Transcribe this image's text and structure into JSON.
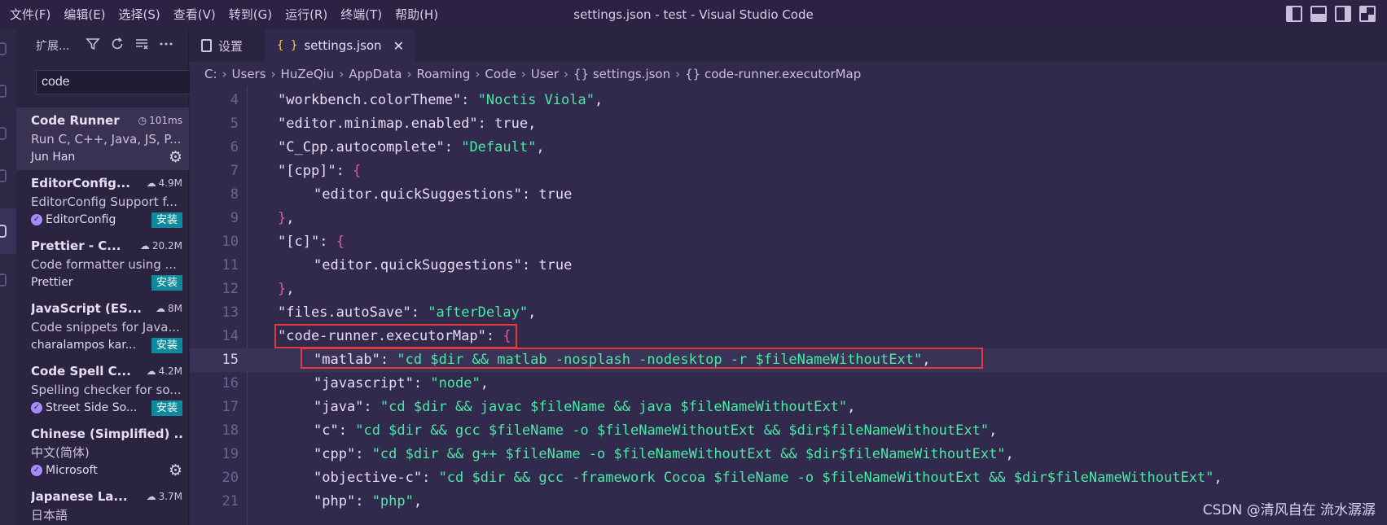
{
  "menu": [
    "文件(F)",
    "编辑(E)",
    "选择(S)",
    "查看(V)",
    "转到(G)",
    "运行(R)",
    "终端(T)",
    "帮助(H)"
  ],
  "window_title": "settings.json - test - Visual Studio Code",
  "sidebar": {
    "title": "扩展...",
    "search_value": "code",
    "extensions": [
      {
        "name": "Code Runner",
        "stat": "101ms",
        "desc": "Run C, C++, Java, JS, P...",
        "publisher": "Jun Han",
        "action": "gear",
        "verified": false
      },
      {
        "name": "EditorConfig...",
        "stat": "4.9M",
        "desc": "EditorConfig Support f...",
        "publisher": "EditorConfig",
        "action": "安装",
        "verified": true
      },
      {
        "name": "Prettier - C...",
        "stat": "20.2M",
        "desc": "Code formatter using ...",
        "publisher": "Prettier",
        "action": "安装",
        "verified": false
      },
      {
        "name": "JavaScript (ES...",
        "stat": "8M",
        "desc": "Code snippets for Java...",
        "publisher": "charalampos kar...",
        "action": "安装",
        "verified": false
      },
      {
        "name": "Code Spell C...",
        "stat": "4.2M",
        "desc": "Spelling checker for so...",
        "publisher": "Street Side So...",
        "action": "安装",
        "verified": true
      },
      {
        "name": "Chinese (Simplified) ...",
        "stat": "",
        "desc": "中文(简体)",
        "publisher": "Microsoft",
        "action": "gear",
        "verified": true
      },
      {
        "name": "Japanese La...",
        "stat": "3.7M",
        "desc": "日本語",
        "publisher": "",
        "action": "",
        "verified": false
      }
    ]
  },
  "tabs": [
    {
      "label": "设置",
      "active": false
    },
    {
      "label": "settings.json",
      "active": true
    }
  ],
  "breadcrumb": [
    "C:",
    "Users",
    "HuZeQiu",
    "AppData",
    "Roaming",
    "Code",
    "User",
    "{} settings.json",
    "{} code-runner.executorMap"
  ],
  "code_lines": [
    {
      "n": "4",
      "text": "\"workbench.colorTheme\": \"Noctis Viola\","
    },
    {
      "n": "5",
      "text": "\"editor.minimap.enabled\": true,"
    },
    {
      "n": "6",
      "text": "\"C_Cpp.autocomplete\": \"Default\","
    },
    {
      "n": "7",
      "text": "\"[cpp]\": {"
    },
    {
      "n": "8",
      "text": "\"editor.quickSuggestions\": true"
    },
    {
      "n": "9",
      "text": "},"
    },
    {
      "n": "10",
      "text": "\"[c]\": {"
    },
    {
      "n": "11",
      "text": "\"editor.quickSuggestions\": true"
    },
    {
      "n": "12",
      "text": "},"
    },
    {
      "n": "13",
      "text": "\"files.autoSave\": \"afterDelay\","
    },
    {
      "n": "14",
      "text": "\"code-runner.executorMap\": {"
    },
    {
      "n": "15",
      "text": "\"matlab\": \"cd $dir && matlab -nosplash -nodesktop -r $fileNameWithoutExt\","
    },
    {
      "n": "16",
      "text": "\"javascript\": \"node\","
    },
    {
      "n": "17",
      "text": "\"java\": \"cd $dir && javac $fileName && java $fileNameWithoutExt\","
    },
    {
      "n": "18",
      "text": "\"c\": \"cd $dir && gcc $fileName -o $fileNameWithoutExt && $dir$fileNameWithoutExt\","
    },
    {
      "n": "19",
      "text": "\"cpp\": \"cd $dir && g++ $fileName -o $fileNameWithoutExt && $dir$fileNameWithoutExt\","
    },
    {
      "n": "20",
      "text": "\"objective-c\": \"cd $dir && gcc -framework Cocoa $fileName -o $fileNameWithoutExt && $dir$fileNameWithoutExt\","
    },
    {
      "n": "21",
      "text": "\"php\": \"php\","
    }
  ],
  "watermark": "CSDN @清风自在 流水潺潺",
  "colors": {
    "string": "#49e9a6",
    "boolean": "#9d7cf4",
    "brace": "#d65c9e",
    "highlight_box": "#e0393f",
    "install": "#0e8a9c"
  }
}
